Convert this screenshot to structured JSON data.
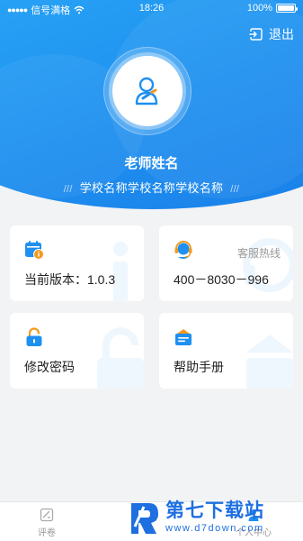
{
  "status_bar": {
    "carrier": "信号满格",
    "time": "18:26",
    "battery": "100%",
    "battery_level": 1.0
  },
  "header": {
    "logout_label": "退出",
    "teacher_name": "老师姓名",
    "school_name": "学校名称学校名称学校名称",
    "school_deco_left": "///",
    "school_deco_right": "///"
  },
  "cards": {
    "version": {
      "label": "当前版本：1.0.3",
      "icon": "calendar-info-icon"
    },
    "hotline": {
      "sub": "客服热线",
      "label": "400－8030－996",
      "icon": "headset-icon"
    },
    "password": {
      "label": "修改密码",
      "icon": "lock-icon"
    },
    "manual": {
      "label": "帮助手册",
      "icon": "manual-icon"
    }
  },
  "tabbar": {
    "tabs": [
      {
        "label": "评卷",
        "icon": "grading-icon"
      },
      {
        "label": "",
        "icon": "person-icon"
      },
      {
        "label": "个人中心",
        "icon": "user-center-icon"
      }
    ]
  },
  "watermark": {
    "title": "第七下载站",
    "url": "www.d7down.com"
  },
  "colors": {
    "primary": "#1e90f0",
    "accent_orange": "#f39a1e",
    "background": "#f2f3f5"
  }
}
